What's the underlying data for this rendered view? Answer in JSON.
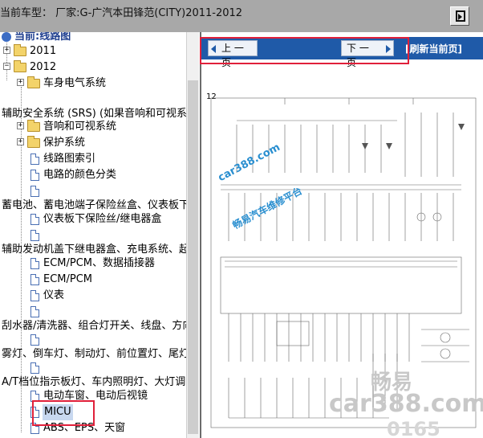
{
  "header": {
    "vehicle_label": "当前车型：  厂家:G-广汽本田锋范(CITY)2011-2012",
    "exit_icon": "exit-icon"
  },
  "tree": {
    "root_label": "当前:线路图",
    "items": [
      {
        "label": "2011"
      },
      {
        "label": "2012"
      },
      {
        "label": "车身电气系统"
      },
      {
        "label": "辅助安全系统 (SRS) (如果音响和可视系统"
      },
      {
        "label": "音响和可视系统"
      },
      {
        "label": "保护系统"
      },
      {
        "label": "线路图索引"
      },
      {
        "label": "电路的颜色分类"
      },
      {
        "label": "蓄电池、蓄电池端子保险丝盒、仪表板下"
      },
      {
        "label": "仪表板下保险丝/继电器盒"
      },
      {
        "label": "辅助发动机盖下继电器盒、充电系统、起"
      },
      {
        "label": "ECM/PCM、数据插接器"
      },
      {
        "label": "ECM/PCM"
      },
      {
        "label": "仪表"
      },
      {
        "label": "刮水器/清洗器、组合灯开关、线盘、方向"
      },
      {
        "label": "雾灯、倒车灯、制动灯、前位置灯、尾灯"
      },
      {
        "label": "A/T档位指示板灯、车内照明灯、大灯调"
      },
      {
        "label": "电动车窗、电动后视镜"
      },
      {
        "label": "MICU"
      },
      {
        "label": "ABS、EPS、天窗"
      }
    ]
  },
  "nav": {
    "prev_label": "上 一 页",
    "next_label": "下 一 页",
    "refresh_label": "[刷新当前页]"
  },
  "diagram": {
    "page_number": "12",
    "watermarks": {
      "site": "car388.com",
      "platform": "畅易汽车维修平台",
      "brand": "畅易",
      "site_large": "car388.com",
      "digits": "0165"
    }
  },
  "colors": {
    "topbar": "#a8a8a8",
    "nav_bar": "#1f5aa8",
    "highlight_outline": "#e0203a",
    "selection": "#c8d8f0"
  }
}
